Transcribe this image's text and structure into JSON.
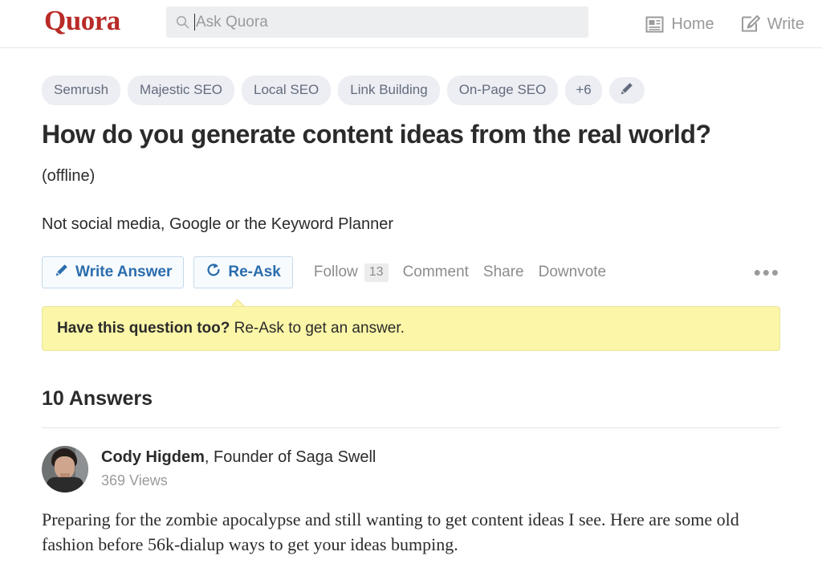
{
  "header": {
    "logo": "Quora",
    "logo_color": "#b92b27",
    "search": {
      "placeholder": "Ask Quora",
      "value": "",
      "icon": "search-icon"
    },
    "nav": [
      {
        "label": "Home",
        "icon": "home-article-icon"
      },
      {
        "label": "Write",
        "icon": "write-pencil-icon"
      }
    ]
  },
  "question": {
    "tags": [
      {
        "label": "Semrush"
      },
      {
        "label": "Majestic SEO"
      },
      {
        "label": "Local SEO"
      },
      {
        "label": "Link Building"
      },
      {
        "label": "On-Page SEO"
      }
    ],
    "tags_more_label": "+6",
    "tags_edit_icon": "pencil-icon",
    "title": "How do you generate content ideas from the real world?",
    "status": "(offline)",
    "detail": "Not social media, Google or the Keyword Planner"
  },
  "actions": {
    "write_answer": {
      "label": "Write Answer",
      "icon": "pencil-icon"
    },
    "re_ask": {
      "label": "Re-Ask",
      "icon": "refresh-circle-icon"
    },
    "follow": {
      "label": "Follow",
      "count": "13"
    },
    "comment": "Comment",
    "share": "Share",
    "downvote": "Downvote",
    "more": "•••"
  },
  "callout": {
    "bold": "Have this question too?",
    "text": " Re-Ask to get an answer.",
    "background": "#fbf6a8"
  },
  "answers": {
    "heading": "10 Answers",
    "items": [
      {
        "author": "Cody Higdem",
        "credential": ", Founder of Saga Swell",
        "views": "369 Views",
        "body": "Preparing for the zombie apocalypse and still wanting to get content ideas I see.  Here are some old fashion before 56k-dialup ways to get your ideas bumping."
      }
    ]
  }
}
